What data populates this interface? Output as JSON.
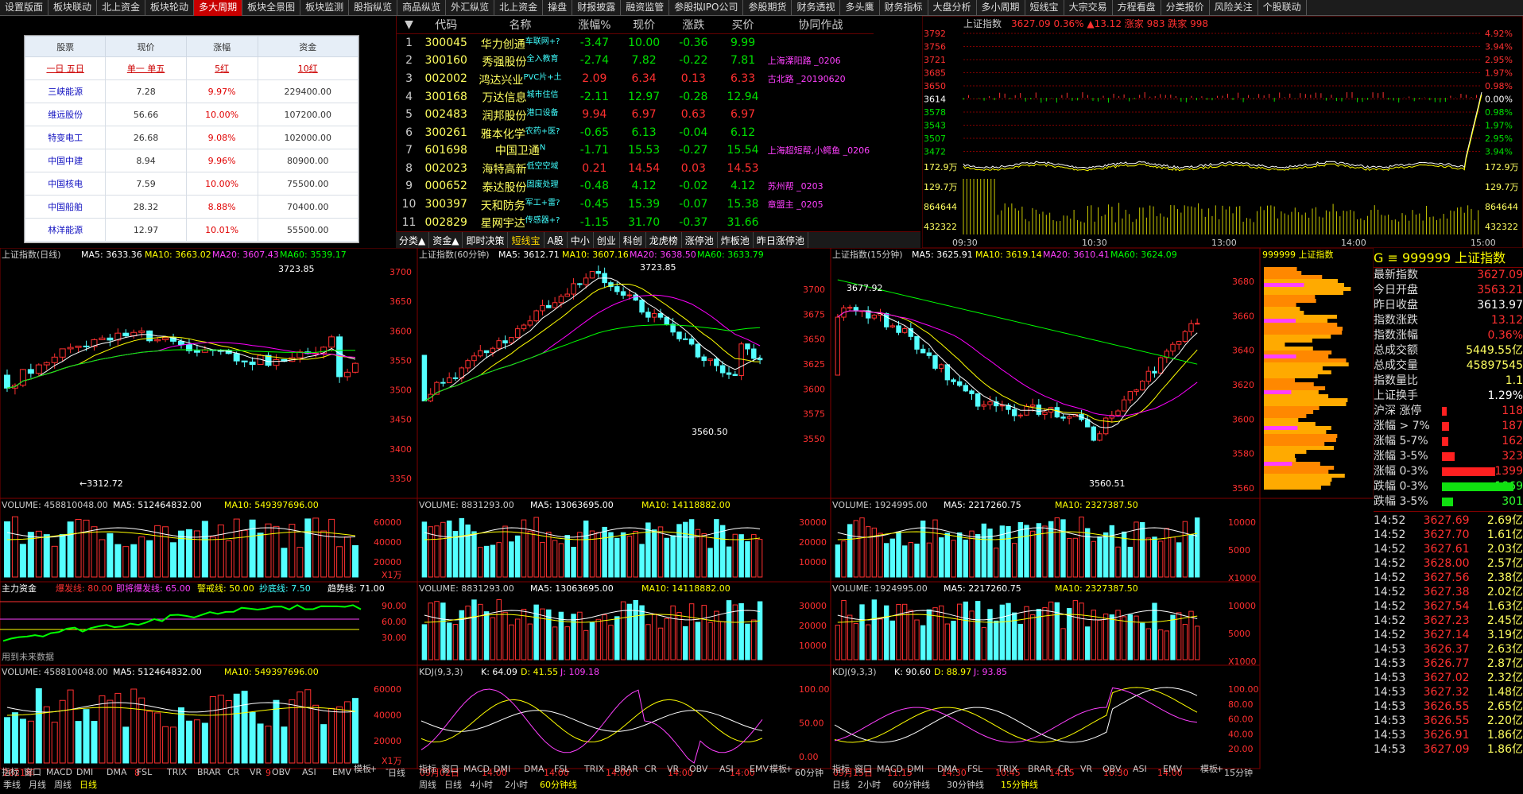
{
  "top_tabs": [
    "设置版面",
    "板块联动",
    "北上资金",
    "板块轮动",
    "多大周期",
    "板块全景图",
    "板块监测",
    "股指纵览",
    "商品纵览",
    "外汇纵览",
    "北上资金",
    "操盘",
    "财报披露",
    "融资监管",
    "参股拟IPO公司",
    "参股期货",
    "财务透视",
    "多头鹰",
    "财务指标",
    "大盘分析",
    "多小周期",
    "短线宝",
    "大宗交易",
    "方程看盘",
    "分类报价",
    "风险关注",
    "个股联动"
  ],
  "active_tab": "多大周期",
  "watch": {
    "headers": [
      "股票",
      "现价",
      "涨幅",
      "资金"
    ],
    "subrow": [
      "一日 五日",
      "单一 单五",
      "5红",
      "10红"
    ],
    "rows": [
      [
        "三峡能源",
        "7.28",
        "9.97%",
        "229400.00"
      ],
      [
        "维远股份",
        "56.66",
        "10.00%",
        "107200.00"
      ],
      [
        "特变电工",
        "26.68",
        "9.08%",
        "102000.00"
      ],
      [
        "中国中建",
        "8.94",
        "9.96%",
        "80900.00"
      ],
      [
        "中国核电",
        "7.59",
        "10.00%",
        "75500.00"
      ],
      [
        "中国船舶",
        "28.32",
        "8.88%",
        "70400.00"
      ],
      [
        "林洋能源",
        "12.97",
        "10.01%",
        "55500.00"
      ]
    ]
  },
  "stocklist": {
    "headers": [
      "代码",
      "名称",
      "涨幅%",
      "现价",
      "涨跌",
      "买价",
      "协同作战"
    ],
    "rows": [
      {
        "n": "1",
        "code": "300045",
        "name": "华力创通",
        "tag": "车联网+?",
        "pct": "-3.47",
        "price": "10.00",
        "chg": "-0.36",
        "bid": "9.99",
        "note": ""
      },
      {
        "n": "2",
        "code": "300160",
        "name": "秀强股份",
        "tag": "全入教育",
        "pct": "-2.74",
        "price": "7.82",
        "chg": "-0.22",
        "bid": "7.81",
        "note": "上海溧阳路  _0206"
      },
      {
        "n": "3",
        "code": "002002",
        "name": "鸿达兴业",
        "tag": "PVC片+土",
        "pct": "2.09",
        "price": "6.34",
        "chg": "0.13",
        "bid": "6.33",
        "note": "古北路  _20190620"
      },
      {
        "n": "4",
        "code": "300168",
        "name": "万达信息",
        "tag": "城市住信",
        "pct": "-2.11",
        "price": "12.97",
        "chg": "-0.28",
        "bid": "12.94",
        "note": ""
      },
      {
        "n": "5",
        "code": "002483",
        "name": "润邦股份",
        "tag": "港口设备",
        "pct": "9.94",
        "price": "6.97",
        "chg": "0.63",
        "bid": "6.97",
        "note": ""
      },
      {
        "n": "6",
        "code": "300261",
        "name": "雅本化学",
        "tag": "农药+医?",
        "pct": "-0.65",
        "price": "6.13",
        "chg": "-0.04",
        "bid": "6.12",
        "note": ""
      },
      {
        "n": "7",
        "code": "601698",
        "name": "中国卫通",
        "tag": "N",
        "pct": "-1.71",
        "price": "15.53",
        "chg": "-0.27",
        "bid": "15.54",
        "note": "上海超短帮,小鳄鱼  _0206"
      },
      {
        "n": "8",
        "code": "002023",
        "name": "海特高新",
        "tag": "低空空域",
        "pct": "0.21",
        "price": "14.54",
        "chg": "0.03",
        "bid": "14.53",
        "note": ""
      },
      {
        "n": "9",
        "code": "000652",
        "name": "泰达股份",
        "tag": "固废处理",
        "pct": "-0.48",
        "price": "4.12",
        "chg": "-0.02",
        "bid": "4.12",
        "note": "苏州帮  _0203"
      },
      {
        "n": "10",
        "code": "300397",
        "name": "天和防务",
        "tag": "军工+雷?",
        "pct": "-0.45",
        "price": "15.39",
        "chg": "-0.07",
        "bid": "15.38",
        "note": "章盟主  _0205"
      },
      {
        "n": "11",
        "code": "002829",
        "name": "星网宇达",
        "tag": "传感器+?",
        "pct": "-1.15",
        "price": "31.70",
        "chg": "-0.37",
        "bid": "31.66",
        "note": ""
      }
    ]
  },
  "categories": [
    "分类▲",
    "资金▲",
    "即时决策",
    "短线宝",
    "A股",
    "中小",
    "创业",
    "科创",
    "龙虎榜",
    "涨停池",
    "炸板池",
    "昨日涨停池"
  ],
  "intraday": {
    "title": "上证指数",
    "price": "3627.09",
    "pct": "0.36%",
    "chg": "▲13.12",
    "up_label": "涨家",
    "up": "983",
    "down_label": "跌家",
    "down": "998",
    "left_ticks": [
      "3792",
      "3756",
      "3721",
      "3685",
      "3650",
      "3614",
      "3578",
      "3543",
      "3507",
      "3472"
    ],
    "right_ticks": [
      "4.92%",
      "3.94%",
      "2.95%",
      "1.97%",
      "0.98%",
      "0.00%",
      "0.98%",
      "1.97%",
      "2.95%",
      "3.94%"
    ],
    "vol_ticks": [
      "172.9万",
      "129.7万",
      "864644",
      "432322"
    ],
    "time_ticks": [
      "09:30",
      "10:30",
      "13:00",
      "14:00",
      "15:00"
    ]
  },
  "daily": {
    "title": "上证指数(日线)",
    "ma5": "MA5: 3633.36",
    "ma10": "MA10: 3663.02",
    "ma20": "MA20: 3607.43",
    "ma60": "MA60: 3539.17",
    "high": "3723.85",
    "low": "←3312.72",
    "ticks": [
      "3700",
      "3650",
      "3600",
      "3550",
      "3500",
      "3450",
      "3400",
      "3350"
    ],
    "vol": "VOLUME: 458810048.00",
    "vma5": "MA5: 512464832.00",
    "vma10": "MA10: 549397696.00",
    "vticks": [
      "60000",
      "40000",
      "20000",
      "X1万"
    ],
    "zl": "主力资金",
    "zl1": "爆发线: 80.00",
    "zl2": "即将爆发线: 65.00",
    "zl3": "警戒线: 50.00",
    "zl4": "抄底线: 7.50",
    "zl5": "趋势线: 71.00",
    "zlticks": [
      "90.00",
      "60.00",
      "30.00"
    ],
    "note": "用到未来数据",
    "dates": [
      "2021年",
      "8",
      "9"
    ],
    "period": "日线"
  },
  "m60": {
    "title": "上证指数(60分钟)",
    "ma5": "MA5: 3612.71",
    "ma10": "MA10: 3607.16",
    "ma20": "MA20: 3638.50",
    "ma60": "MA60: 3633.79",
    "high": "3723.85",
    "low": "3560.50",
    "ticks": [
      "3700",
      "3675",
      "3650",
      "3625",
      "3600",
      "3575",
      "3550"
    ],
    "vol": "VOLUME: 8831293.00",
    "vma5": "MA5: 13063695.00",
    "vma10": "MA10: 14118882.00",
    "vticks": [
      "30000",
      "20000",
      "10000"
    ],
    "kdj": "KDJ(9,3,3)",
    "k": "K: 64.09",
    "d": "D: 41.55",
    "j": "J: 109.18",
    "kticks": [
      "100.00",
      "50.00",
      "0.00"
    ],
    "dates": [
      "09月02日",
      "14:00",
      "14:00",
      "14:00",
      "14:00",
      "14:00"
    ],
    "period": "60分钟"
  },
  "m15": {
    "title": "上证指数(15分钟)",
    "ma5": "MA5: 3625.91",
    "ma10": "MA10: 3619.14",
    "ma20": "MA20: 3610.41",
    "ma60": "MA60: 3624.09",
    "high": "3677.92",
    "low": "3560.51",
    "ticks": [
      "3680",
      "3660",
      "3640",
      "3620",
      "3600",
      "3580",
      "3560"
    ],
    "vol": "VOLUME: 1924995.00",
    "vma5": "MA5: 2217260.75",
    "vma10": "MA10: 2327387.50",
    "vticks": [
      "10000",
      "5000",
      "X1000"
    ],
    "kdj": "KDJ(9,3,3)",
    "k": "K: 90.60",
    "d": "D: 88.97",
    "j": "J: 93.85",
    "kticks": [
      "100.00",
      "80.00",
      "60.00",
      "40.00",
      "20.00"
    ],
    "dates": [
      "09月15日",
      "11:15",
      "14:30",
      "10:45",
      "14:15",
      "10:30",
      "14:00"
    ],
    "period": "15分钟"
  },
  "profile": {
    "title": "999999 上证指数",
    "ticks": [
      "3680",
      "3660",
      "3640",
      "3620",
      "3600",
      "3580",
      "3560"
    ]
  },
  "sidebar": {
    "code": "999999",
    "name": "上证指数",
    "rows": [
      [
        "最新指数",
        "3627.09"
      ],
      [
        "今日开盘",
        "3563.21"
      ],
      [
        "昨日收盘",
        "3613.97"
      ],
      [
        "指数涨跌",
        "13.12"
      ],
      [
        "指数涨幅",
        "0.36%"
      ],
      [
        "总成交额",
        "5449.55亿"
      ],
      [
        "总成交量",
        "45897545"
      ],
      [
        "指数量比",
        "1.1"
      ],
      [
        "上证换手",
        "1.29%"
      ]
    ],
    "breadth": [
      [
        "沪深 涨停",
        "118"
      ],
      [
        "涨幅 > 7%",
        "187"
      ],
      [
        "涨幅 5-7%",
        "162"
      ],
      [
        "涨幅 3-5%",
        "323"
      ],
      [
        "涨幅 0-3%",
        "1399"
      ],
      [
        "跌幅 0-3%",
        "1869"
      ],
      [
        "跌幅 3-5%",
        "301"
      ]
    ],
    "ticks": [
      [
        "14:52",
        "3627.69",
        "2.69亿"
      ],
      [
        "14:52",
        "3627.70",
        "1.61亿"
      ],
      [
        "14:52",
        "3627.61",
        "2.03亿"
      ],
      [
        "14:52",
        "3628.00",
        "2.57亿"
      ],
      [
        "14:52",
        "3627.56",
        "2.38亿"
      ],
      [
        "14:52",
        "3627.38",
        "2.02亿"
      ],
      [
        "14:52",
        "3627.54",
        "1.63亿"
      ],
      [
        "14:52",
        "3627.23",
        "2.45亿"
      ],
      [
        "14:52",
        "3627.14",
        "3.19亿"
      ],
      [
        "14:53",
        "3626.37",
        "2.63亿"
      ],
      [
        "14:53",
        "3626.77",
        "2.87亿"
      ],
      [
        "14:53",
        "3627.02",
        "2.32亿"
      ],
      [
        "14:53",
        "3627.32",
        "1.48亿"
      ],
      [
        "14:53",
        "3626.55",
        "2.65亿"
      ],
      [
        "14:53",
        "3626.55",
        "2.20亿"
      ],
      [
        "14:53",
        "3626.91",
        "1.86亿"
      ],
      [
        "14:53",
        "3627.09",
        "1.86亿"
      ]
    ]
  },
  "indicators": [
    "指标",
    "窗口",
    "MACD",
    "DMI",
    "DMA",
    "FSL",
    "TRIX",
    "BRAR",
    "CR",
    "VR",
    "OBV",
    "ASI",
    "EMV",
    ">",
    "模板",
    "+",
    "-"
  ],
  "bottom1": [
    "季线",
    "月线",
    "周线",
    "日线"
  ],
  "bottom2": [
    "周线",
    "日线",
    "4小时",
    "2小时",
    "60分钟线"
  ],
  "bottom3": [
    "日线",
    "2小时",
    "60分钟线",
    "30分钟线",
    "15分钟线"
  ],
  "colors": {
    "up": "#ff3030",
    "down": "#54ffff",
    "ma5": "#ffffff",
    "ma10": "#ffff00",
    "ma20": "#ff00ff",
    "ma60": "#00ff00",
    "grid": "#800000"
  }
}
